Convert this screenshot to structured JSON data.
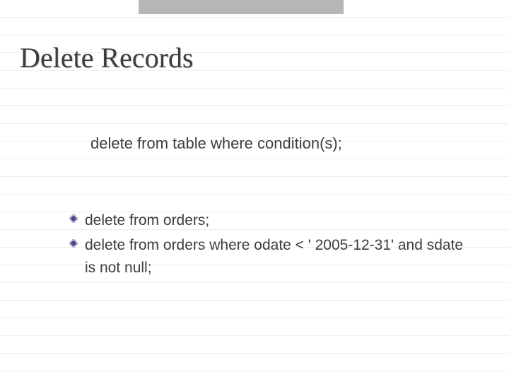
{
  "slide": {
    "title": "Delete Records",
    "syntax": "delete from table where condition(s);",
    "bullets": [
      "delete from orders;",
      "delete from orders where odate < ' 2005-12-31' and sdate is not null;"
    ]
  }
}
